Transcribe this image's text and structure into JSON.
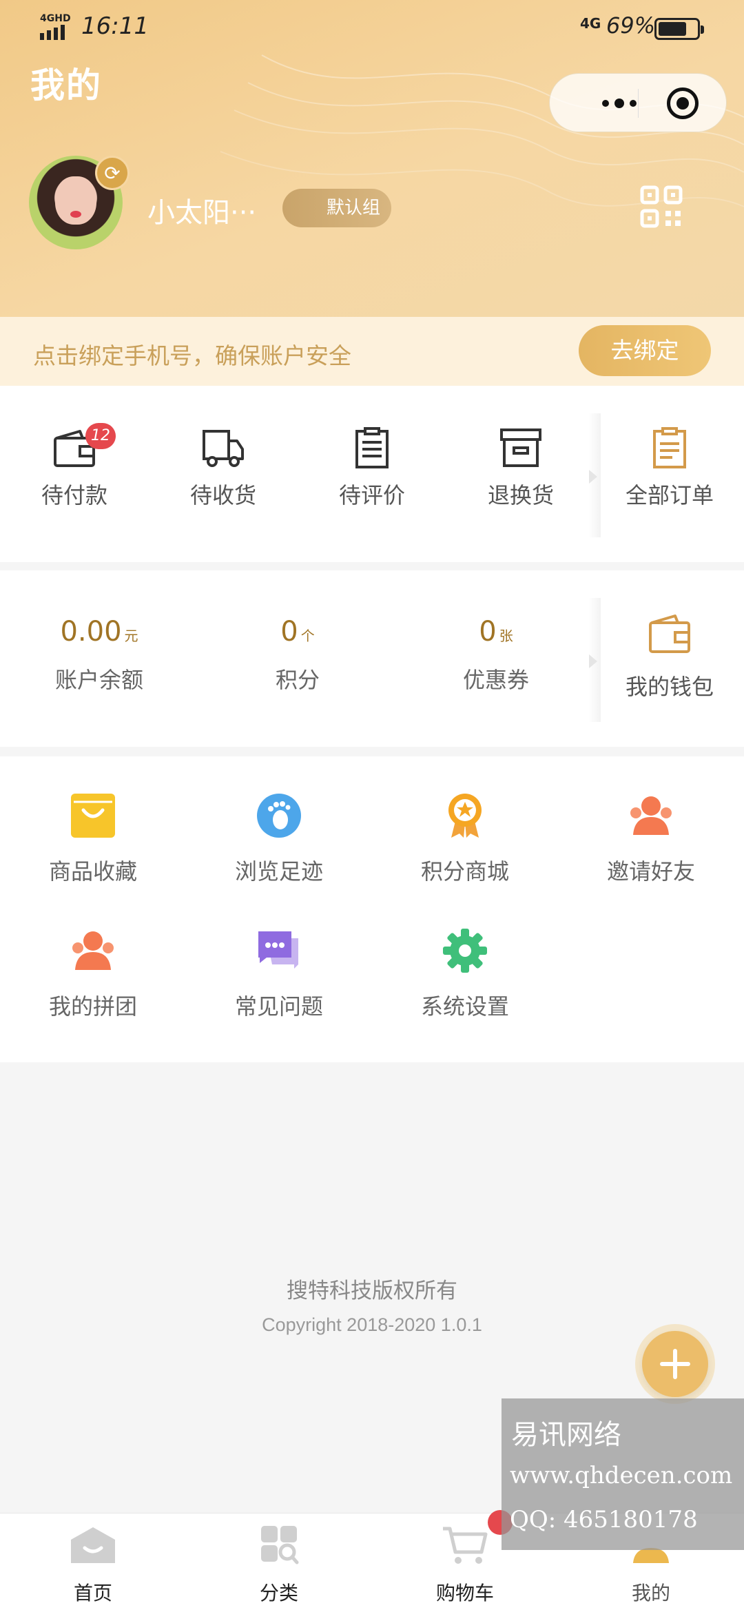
{
  "status_bar": {
    "network_left": "4GHD",
    "time": "16:11",
    "network_right": "4G",
    "battery": "69%"
  },
  "header": {
    "title": "我的",
    "username": "小太阳···",
    "group": "默认组"
  },
  "bind_phone": {
    "text": "点击绑定手机号，确保账户安全",
    "button": "去绑定"
  },
  "orders": {
    "items": [
      {
        "label": "待付款",
        "icon": "wallet-icon",
        "badge": "12"
      },
      {
        "label": "待收货",
        "icon": "truck-icon"
      },
      {
        "label": "待评价",
        "icon": "clipboard-icon"
      },
      {
        "label": "退换货",
        "icon": "box-icon"
      }
    ],
    "all": {
      "label": "全部订单",
      "icon": "order-list-icon"
    }
  },
  "assets": {
    "items": [
      {
        "value": "0.00",
        "unit": "元",
        "label": "账户余额"
      },
      {
        "value": "0",
        "unit": "个",
        "label": "积分"
      },
      {
        "value": "0",
        "unit": "张",
        "label": "优惠券"
      }
    ],
    "wallet": {
      "label": "我的钱包",
      "icon": "wallet-icon"
    }
  },
  "tools": [
    {
      "label": "商品收藏",
      "icon": "shopping-bag-icon"
    },
    {
      "label": "浏览足迹",
      "icon": "footprint-icon"
    },
    {
      "label": "积分商城",
      "icon": "medal-icon"
    },
    {
      "label": "邀请好友",
      "icon": "friends-icon"
    },
    {
      "label": "我的拼团",
      "icon": "group-icon"
    },
    {
      "label": "常见问题",
      "icon": "chat-icon"
    },
    {
      "label": "系统设置",
      "icon": "gear-icon"
    }
  ],
  "footer": {
    "company": "搜特科技版权所有",
    "copyright": "Copyright 2018-2020 1.0.1"
  },
  "tabbar": [
    {
      "label": "首页",
      "icon": "home-icon"
    },
    {
      "label": "分类",
      "icon": "category-icon"
    },
    {
      "label": "购物车",
      "icon": "cart-icon"
    },
    {
      "label": "我的",
      "icon": "user-icon"
    }
  ],
  "watermark": {
    "name": "易讯网络",
    "site": "www.qhdecen.com",
    "qq": "QQ: 465180178"
  },
  "colors": {
    "accent": "#e4b562",
    "badge": "#e5484d",
    "asset_value": "#a07425"
  }
}
